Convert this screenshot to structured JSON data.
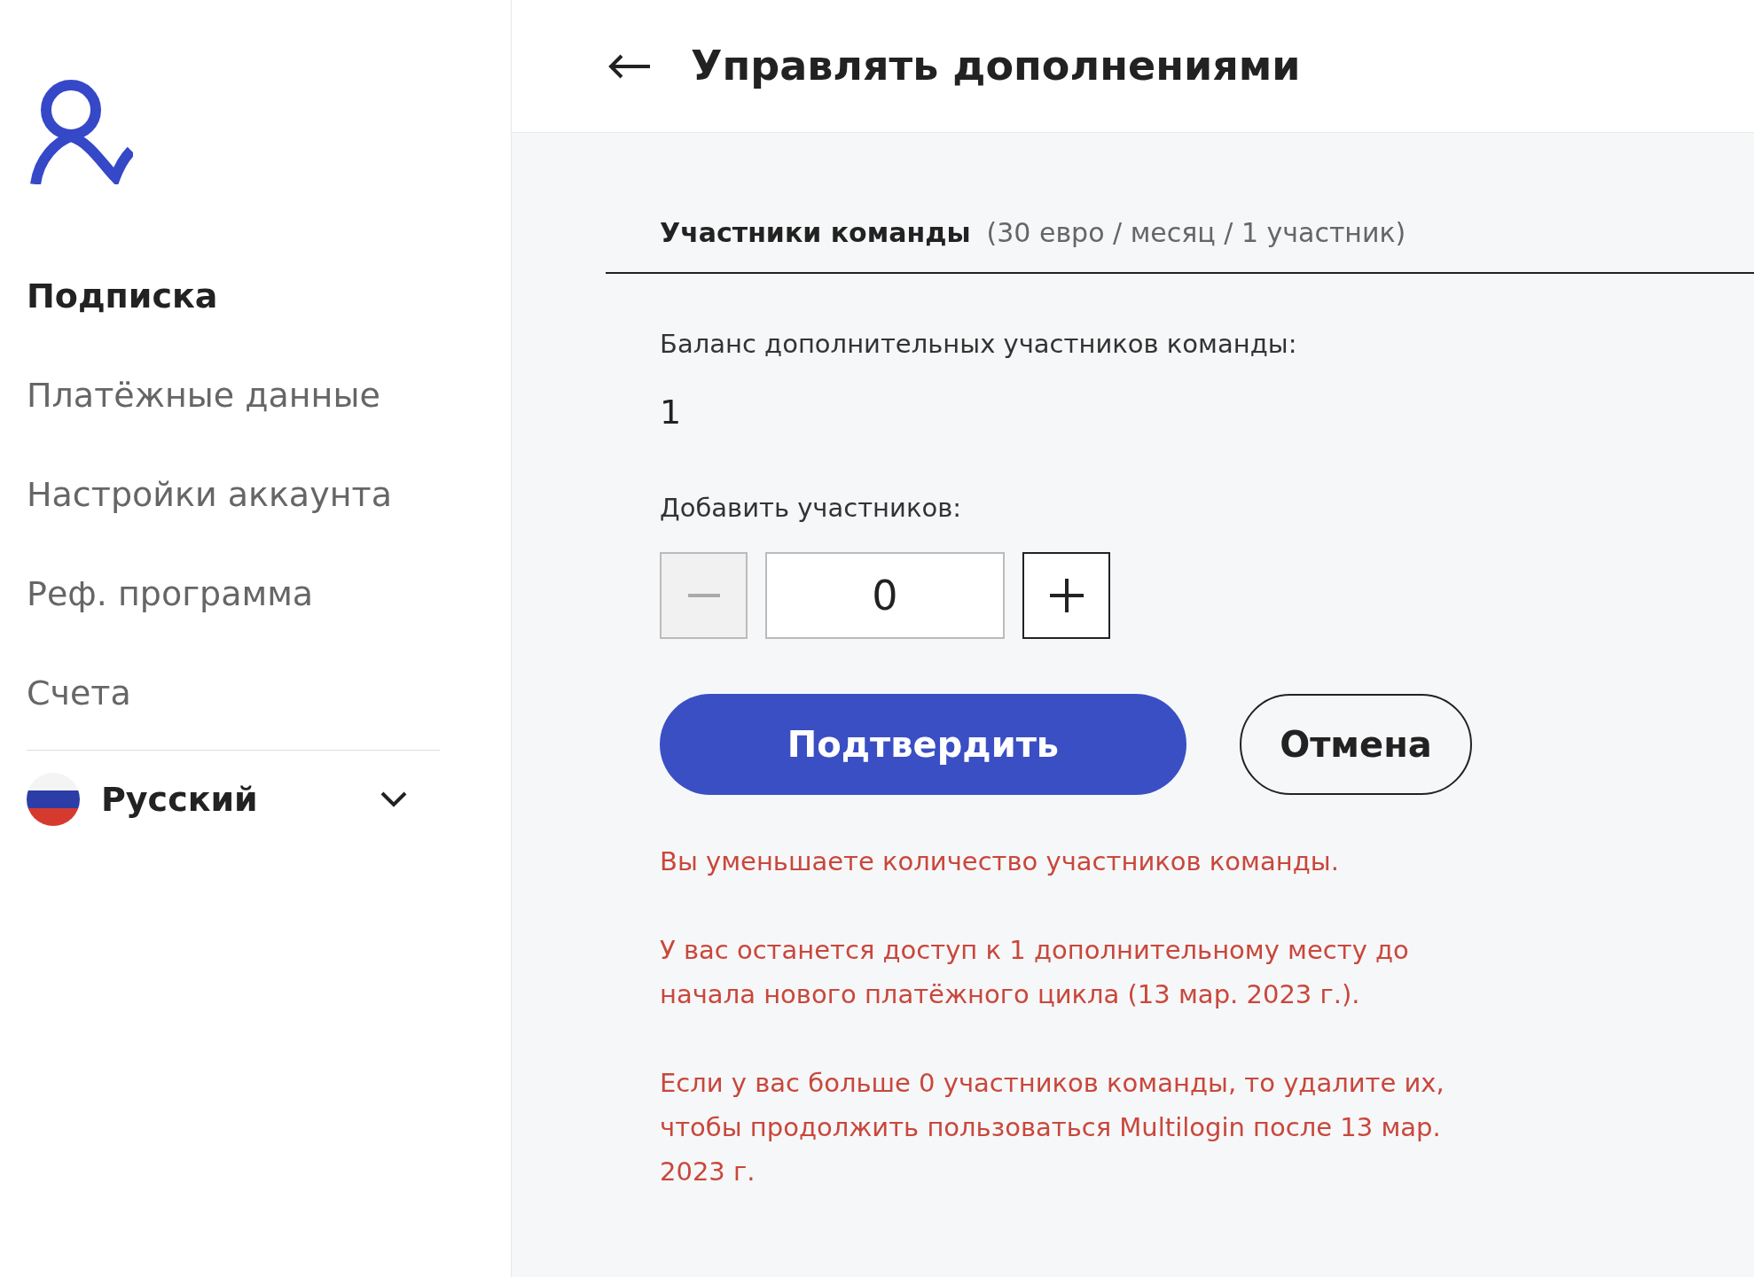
{
  "sidebar": {
    "items": [
      {
        "label": "Подписка",
        "selected": true
      },
      {
        "label": "Платёжные данные",
        "selected": false
      },
      {
        "label": "Настройки аккаунта",
        "selected": false
      },
      {
        "label": "Реф. программа",
        "selected": false
      },
      {
        "label": "Счета",
        "selected": false
      }
    ],
    "language": {
      "label": "Русский",
      "expanded": false
    }
  },
  "header": {
    "title": "Управлять дополнениями"
  },
  "section": {
    "title": "Участники команды",
    "price": "(30 евро / месяц / 1 участник)"
  },
  "balance": {
    "label": "Баланс дополнительных участников команды:",
    "value": "1"
  },
  "add": {
    "label": "Добавить участников:",
    "value": "0",
    "decrement_disabled": true,
    "increment_disabled": false
  },
  "buttons": {
    "confirm": "Подтвердить",
    "cancel": "Отмена"
  },
  "warnings": [
    "Вы уменьшаете количество участников команды.",
    "У вас останется доступ к 1 дополнительному месту до начала нового платёжного цикла (13 мар. 2023 г.).",
    "Если у вас больше 0 участников команды, то удалите их, чтобы продолжить пользоваться Multilogin после 13 мар. 2023 г."
  ]
}
